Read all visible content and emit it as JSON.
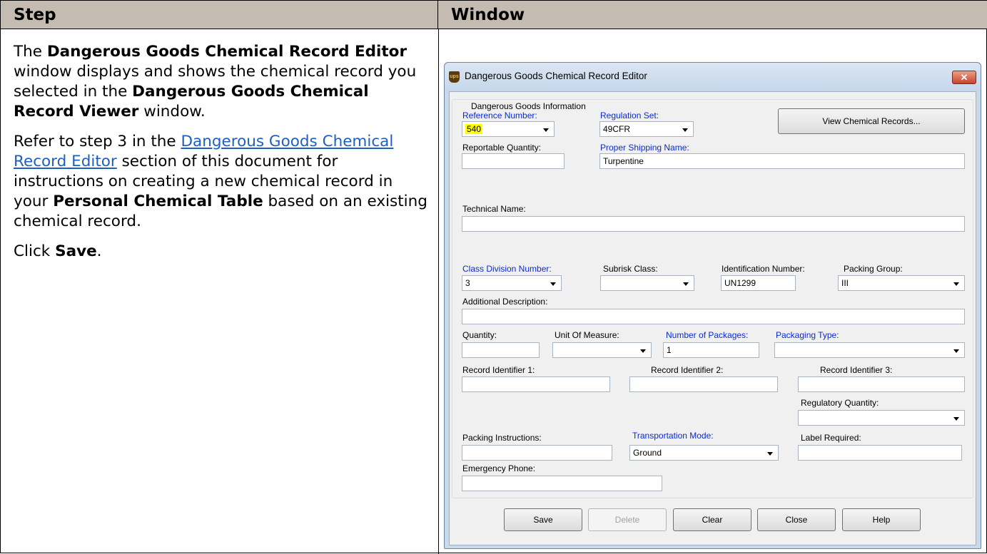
{
  "table": {
    "header_step": "Step",
    "header_window": "Window"
  },
  "step": {
    "p1_a": "The ",
    "p1_b": "Dangerous Goods Chemical Record Editor",
    "p1_c": " window displays and shows the chemical record you selected in the ",
    "p1_d": "Dangerous Goods Chemical Record Viewer",
    "p1_e": " window.",
    "p2_a": "Refer to step 3 in the ",
    "p2_link": "Dangerous Goods Chemical Record Editor",
    "p2_b": " section of this document for instructions on creating a new chemical record in your ",
    "p2_c": "Personal Chemical Table",
    "p2_d": " based on an existing chemical record.",
    "p3_a": "Click ",
    "p3_b": "Save",
    "p3_c": "."
  },
  "dialog": {
    "title": "Dangerous Goods Chemical Record Editor",
    "app_icon_text": "ups",
    "close_glyph": "✕",
    "group_title": "Dangerous Goods Information",
    "fields": {
      "reference_number": {
        "label": "Reference Number:",
        "value": "540"
      },
      "regulation_set": {
        "label": "Regulation Set:",
        "value": "49CFR"
      },
      "view_chemical_records": "View Chemical Records...",
      "reportable_quantity": {
        "label": "Reportable Quantity:",
        "value": ""
      },
      "proper_shipping_name": {
        "label": "Proper Shipping Name:",
        "value": "Turpentine"
      },
      "technical_name": {
        "label": "Technical Name:",
        "value": ""
      },
      "class_division_number": {
        "label": "Class Division Number:",
        "value": "3"
      },
      "subrisk_class": {
        "label": "Subrisk Class:",
        "value": ""
      },
      "identification_number": {
        "label": "Identification Number:",
        "value": "UN1299"
      },
      "packing_group": {
        "label": "Packing Group:",
        "value": "III"
      },
      "additional_description": {
        "label": "Additional Description:",
        "value": ""
      },
      "quantity": {
        "label": "Quantity:",
        "value": ""
      },
      "unit_of_measure": {
        "label": "Unit Of Measure:",
        "value": ""
      },
      "number_of_packages": {
        "label": "Number of Packages:",
        "value": "1"
      },
      "packaging_type": {
        "label": "Packaging Type:",
        "value": ""
      },
      "record_identifier_1": {
        "label": "Record Identifier 1:",
        "value": ""
      },
      "record_identifier_2": {
        "label": "Record Identifier 2:",
        "value": ""
      },
      "record_identifier_3": {
        "label": "Record Identifier 3:",
        "value": ""
      },
      "regulatory_quantity": {
        "label": "Regulatory Quantity:",
        "value": ""
      },
      "packing_instructions": {
        "label": "Packing Instructions:",
        "value": ""
      },
      "transportation_mode": {
        "label": "Transportation Mode:",
        "value": "Ground"
      },
      "label_required": {
        "label": "Label Required:",
        "value": ""
      },
      "emergency_phone": {
        "label": "Emergency Phone:",
        "value": ""
      }
    },
    "buttons": {
      "save": "Save",
      "delete": "Delete",
      "clear": "Clear",
      "close": "Close",
      "help": "Help"
    }
  }
}
